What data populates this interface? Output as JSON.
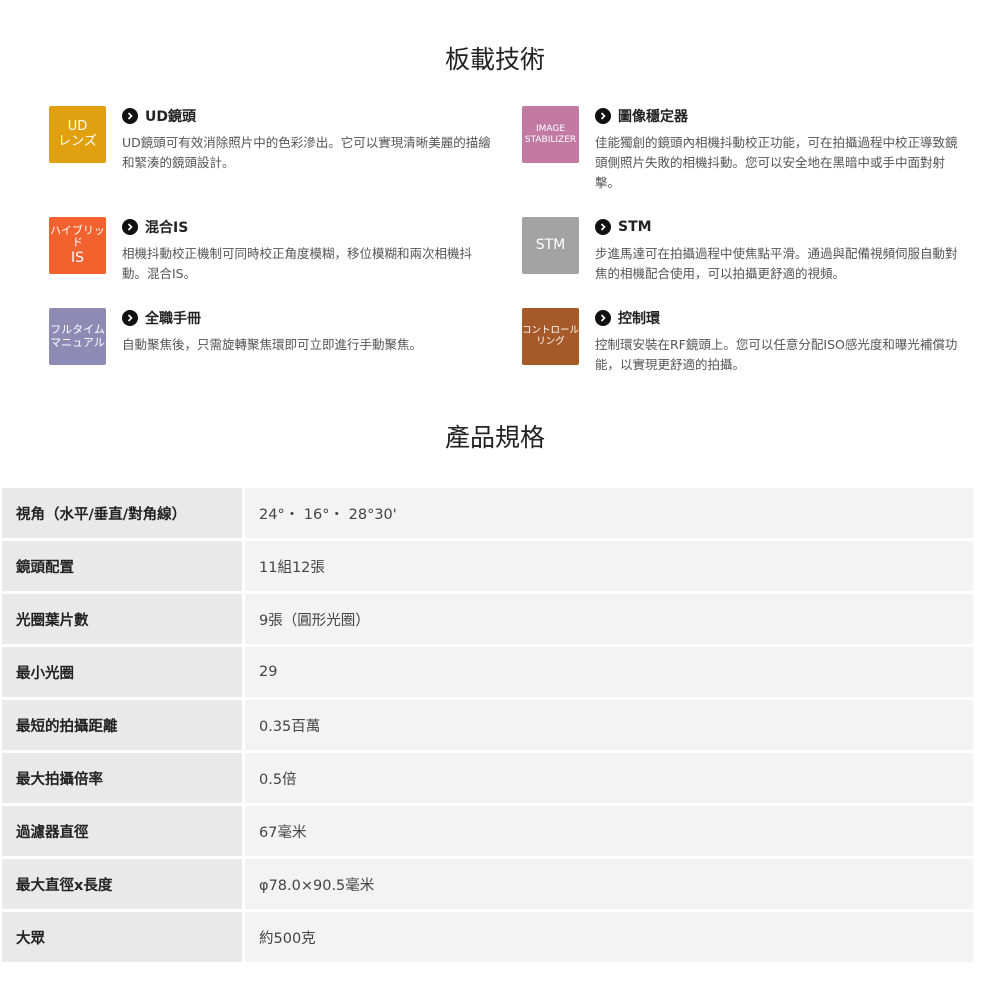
{
  "tech_section": {
    "title": "板載技術",
    "features": [
      {
        "badge_lines": [
          "UD",
          "レンズ"
        ],
        "badge_color": "#e0a00f",
        "title": "UD鏡頭",
        "desc": "UD鏡頭可有效消除照片中的色彩滲出。它可以實現清晰美麗的描繪和緊湊的鏡頭設計。"
      },
      {
        "badge_lines": [
          "IMAGE",
          "STABILIZER"
        ],
        "badge_color": "#c27aa2",
        "title": "圖像穩定器",
        "desc": "佳能獨創的鏡頭內相機抖動校正功能，可在拍攝過程中校正導致鏡頭側照片失敗的相機抖動。您可以安全地在黑暗中或手中面對射擊。"
      },
      {
        "badge_lines": [
          "ハイブリッド",
          "IS"
        ],
        "badge_color": "#f2622e",
        "title": "混合IS",
        "desc": "相機抖動校正機制可同時校正角度模糊，移位模糊和兩次相機抖動。混合IS。"
      },
      {
        "badge_lines": [
          "STM"
        ],
        "badge_color": "#a3a3a3",
        "title": "STM",
        "desc": "步進馬達可在拍攝過程中使焦點平滑。通過與配備視頻伺服自動對焦的相機配合使用，可以拍攝更舒適的視頻。"
      },
      {
        "badge_lines": [
          "フルタイム",
          "マニュアル"
        ],
        "badge_color": "#8d8bb4",
        "title": "全職手冊",
        "desc": "自動聚焦後，只需旋轉聚焦環即可立即進行手動聚焦。"
      },
      {
        "badge_lines": [
          "コントロール",
          "リング"
        ],
        "badge_color": "#a65a2a",
        "title": "控制環",
        "desc": "控制環安裝在RF鏡頭上。您可以任意分配ISO感光度和曝光補償功能，以實現更舒適的拍攝。"
      }
    ]
  },
  "spec_section": {
    "title": "產品規格",
    "rows": [
      {
        "label": "視角（水平/垂直/對角線）",
        "value": "24°・ 16°・ 28°30'"
      },
      {
        "label": "鏡頭配置",
        "value": "11組12張"
      },
      {
        "label": "光圈葉片數",
        "value": "9張（圓形光圈）"
      },
      {
        "label": "最小光圈",
        "value": "29"
      },
      {
        "label": "最短的拍攝距離",
        "value": "0.35百萬"
      },
      {
        "label": "最大拍攝倍率",
        "value": "0.5倍"
      },
      {
        "label": "過濾器直徑",
        "value": "67毫米"
      },
      {
        "label": "最大直徑x長度",
        "value": "φ78.0×90.5毫米"
      },
      {
        "label": "大眾",
        "value": "約500克"
      }
    ]
  },
  "icons": {
    "feature_bullet": "chevron-right-circle-icon"
  }
}
